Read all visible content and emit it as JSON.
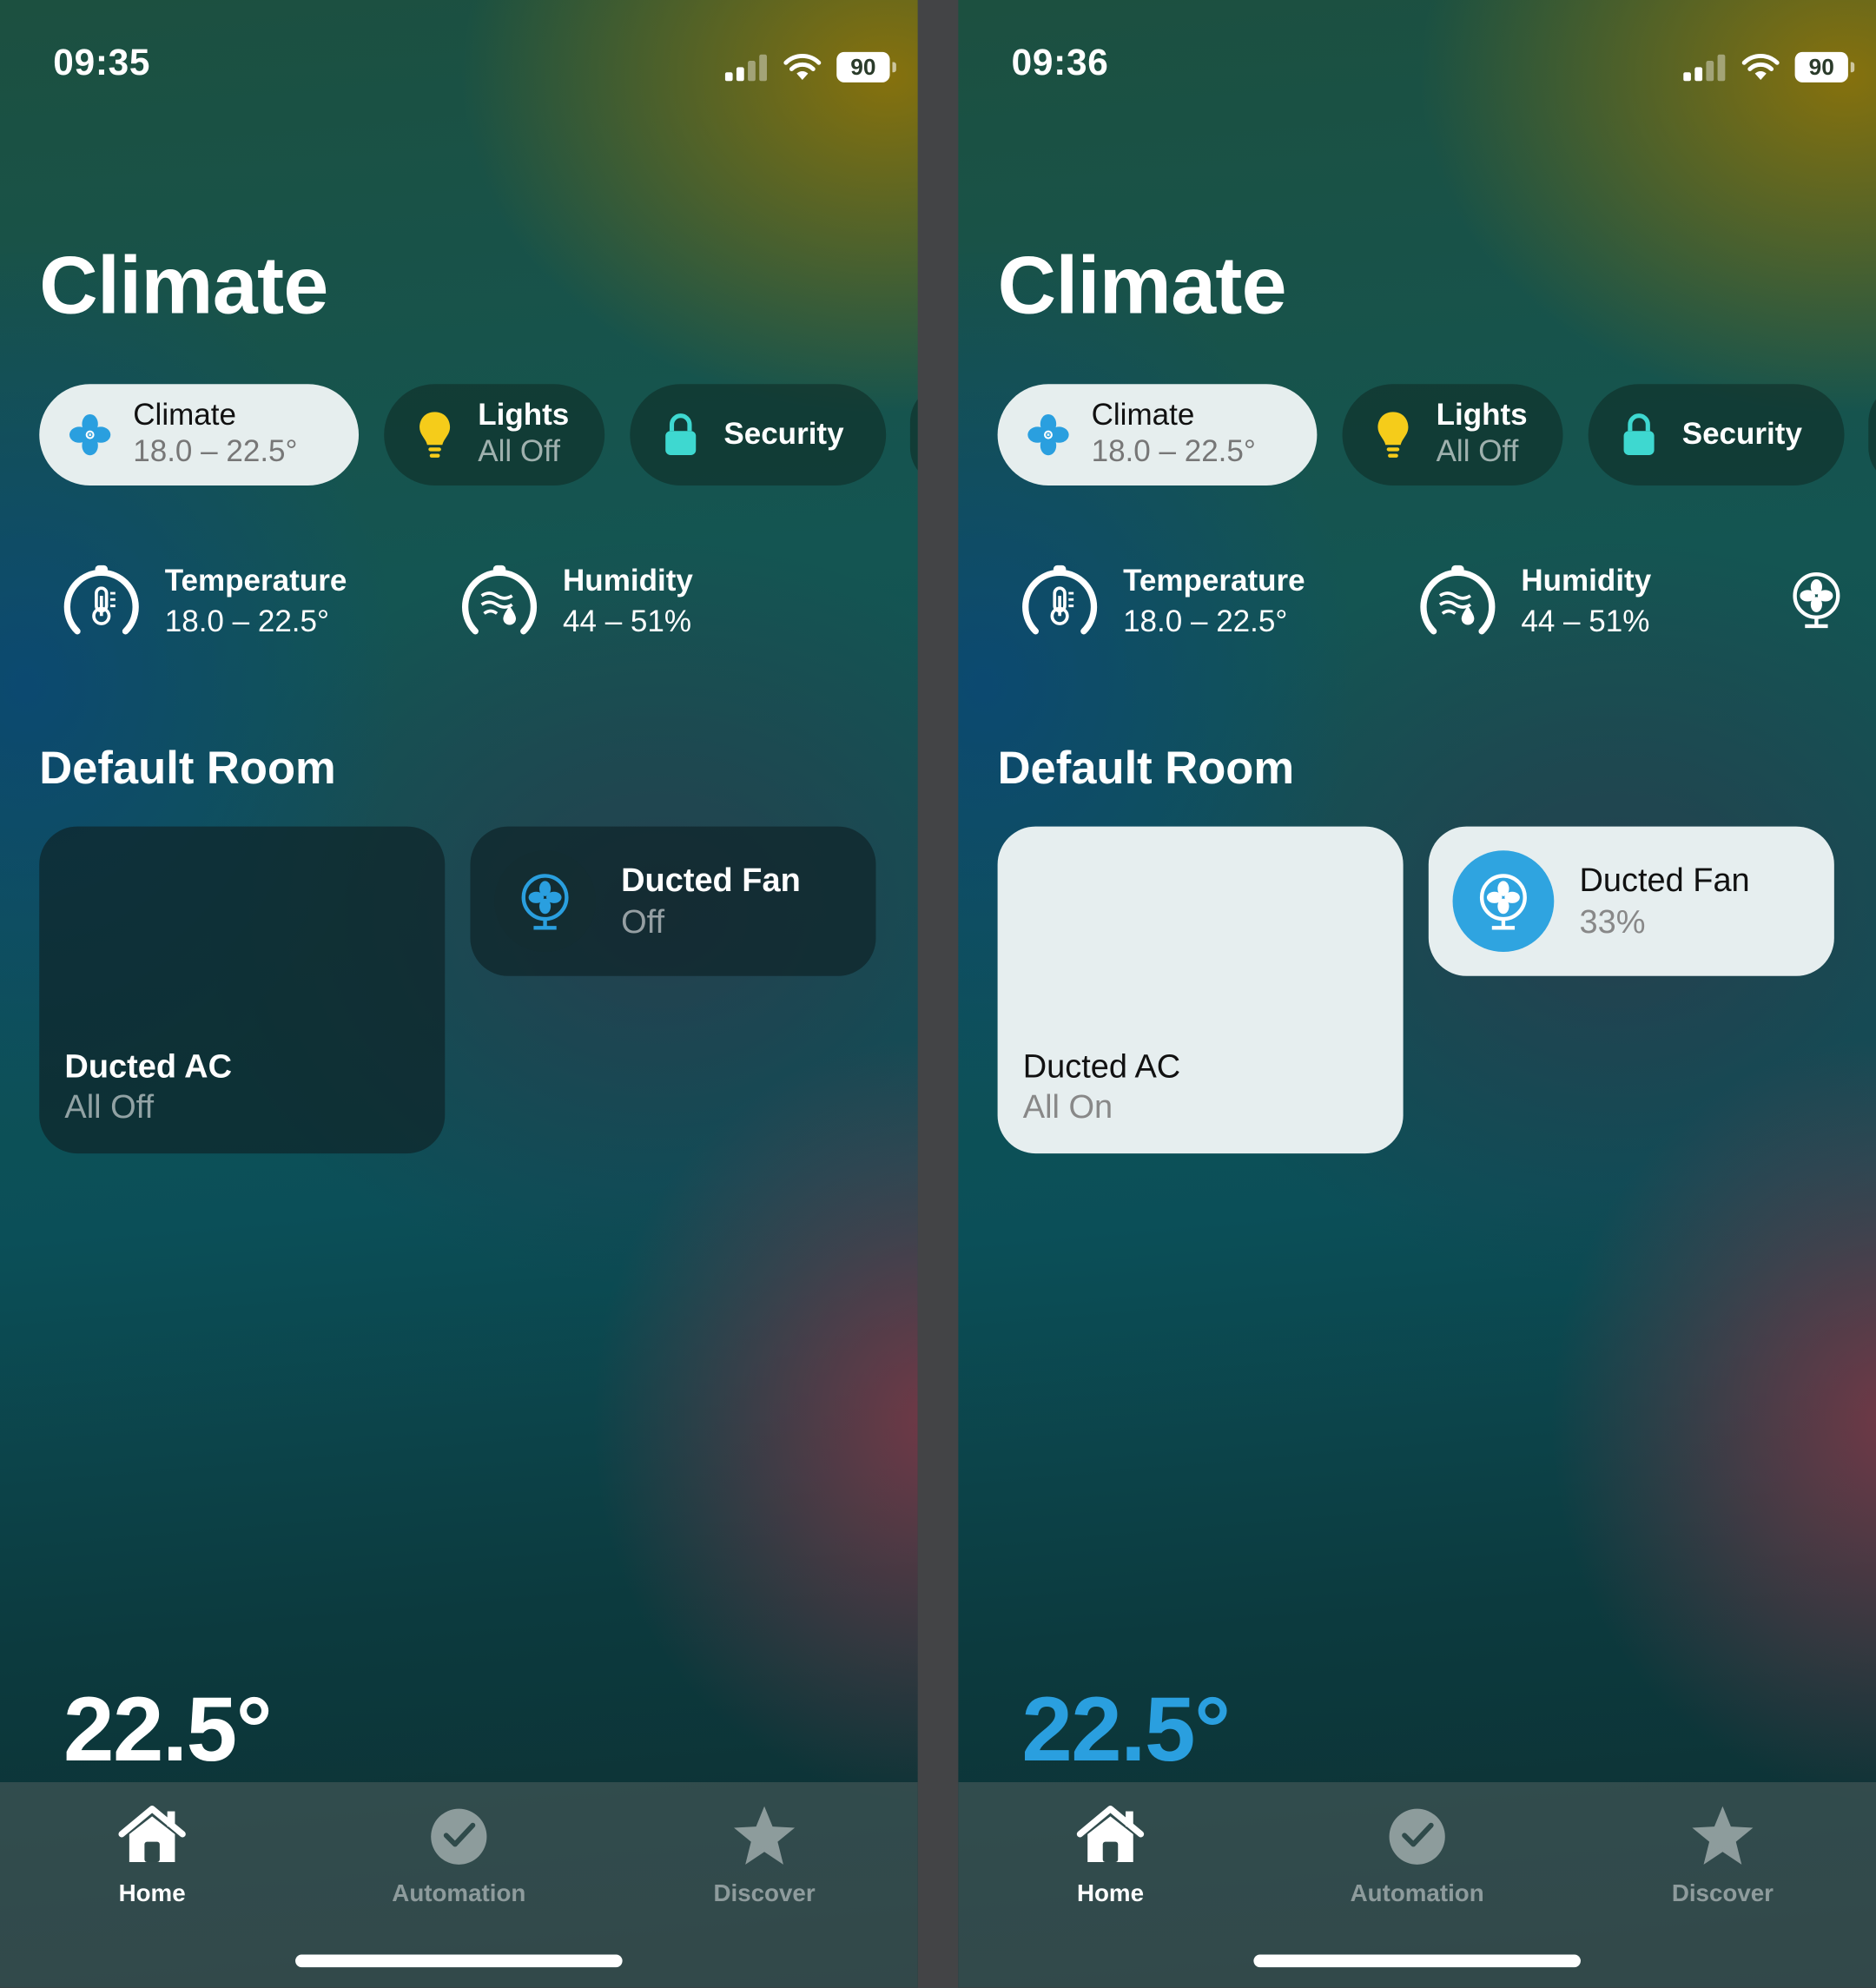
{
  "screens": [
    {
      "status": {
        "time": "09:35",
        "battery": "90"
      },
      "title": "Climate",
      "chips": [
        {
          "label": "Climate",
          "sub": "18.0 – 22.5°",
          "icon": "fan-icon",
          "active": true
        },
        {
          "label": "Lights",
          "sub": "All Off",
          "icon": "lightbulb-icon"
        },
        {
          "label": "Security",
          "icon": "lock-icon"
        }
      ],
      "sensors": [
        {
          "label": "Temperature",
          "value": "18.0 – 22.5°",
          "icon": "thermometer-gauge-icon"
        },
        {
          "label": "Humidity",
          "value": "44 – 51%",
          "icon": "humidity-gauge-icon"
        }
      ],
      "room": "Default Room",
      "ac": {
        "temp": "22.5°",
        "name": "Ducted AC",
        "state": "All Off"
      },
      "fan": {
        "name": "Ducted Fan",
        "state": "Off"
      },
      "tabs": [
        {
          "label": "Home",
          "icon": "house-icon",
          "selected": true
        },
        {
          "label": "Automation",
          "icon": "clock-check-icon"
        },
        {
          "label": "Discover",
          "icon": "star-icon"
        }
      ]
    },
    {
      "status": {
        "time": "09:36",
        "battery": "90"
      },
      "title": "Climate",
      "chips": [
        {
          "label": "Climate",
          "sub": "18.0 – 22.5°",
          "icon": "fan-icon",
          "active": true
        },
        {
          "label": "Lights",
          "sub": "All Off",
          "icon": "lightbulb-icon"
        },
        {
          "label": "Security",
          "icon": "lock-icon"
        }
      ],
      "sensors": [
        {
          "label": "Temperature",
          "value": "18.0 – 22.5°",
          "icon": "thermometer-gauge-icon"
        },
        {
          "label": "Humidity",
          "value": "44 – 51%",
          "icon": "humidity-gauge-icon"
        }
      ],
      "room": "Default Room",
      "ac": {
        "temp": "22.5°",
        "name": "Ducted AC",
        "state": "All On"
      },
      "fan": {
        "name": "Ducted Fan",
        "state": "33%"
      },
      "tabs": [
        {
          "label": "Home",
          "icon": "house-icon",
          "selected": true
        },
        {
          "label": "Automation",
          "icon": "clock-check-icon"
        },
        {
          "label": "Discover",
          "icon": "star-icon"
        }
      ]
    }
  ],
  "colors": {
    "accent_blue": "#2a9fdf",
    "fan_on": "#2fa4e0",
    "lock": "#3ed8d0",
    "bulb": "#f5cc1a"
  }
}
